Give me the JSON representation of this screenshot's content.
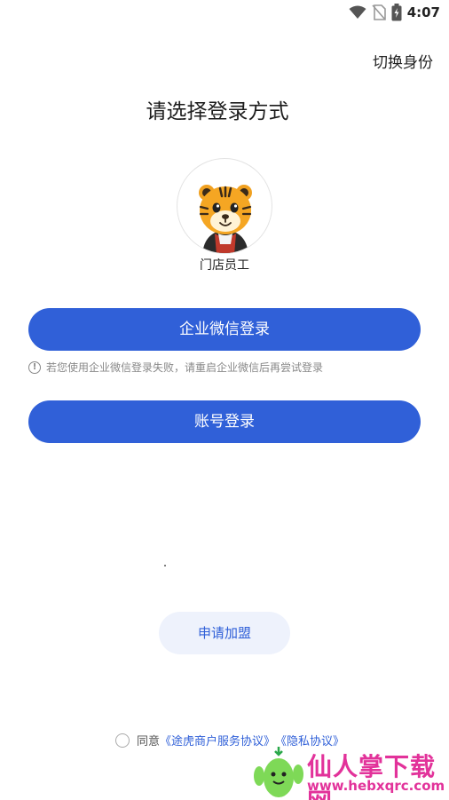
{
  "status_bar": {
    "time": "4:07",
    "icons": [
      "wifi-icon",
      "no-sim-icon",
      "battery-charging-icon"
    ]
  },
  "header": {
    "switch_identity": "切换身份",
    "title": "请选择登录方式"
  },
  "role": {
    "avatar": "tiger-avatar-icon",
    "label": "门店员工"
  },
  "buttons": {
    "wecom_login": "企业微信登录",
    "account_login": "账号登录",
    "apply_join": "申请加盟"
  },
  "hint": {
    "text": "若您使用企业微信登录失败，请重启企业微信后再尝试登录"
  },
  "agreement": {
    "prefix": "同意",
    "service_link": "《途虎商户服务协议》",
    "privacy_link": "《隐私协议》",
    "checked": false
  },
  "watermark": {
    "name": "仙人掌下载网",
    "url": "www.hebxqrc.com"
  },
  "colors": {
    "primary": "#3060d8",
    "join_bg": "#eef2fc",
    "watermark": "#e2329a"
  }
}
